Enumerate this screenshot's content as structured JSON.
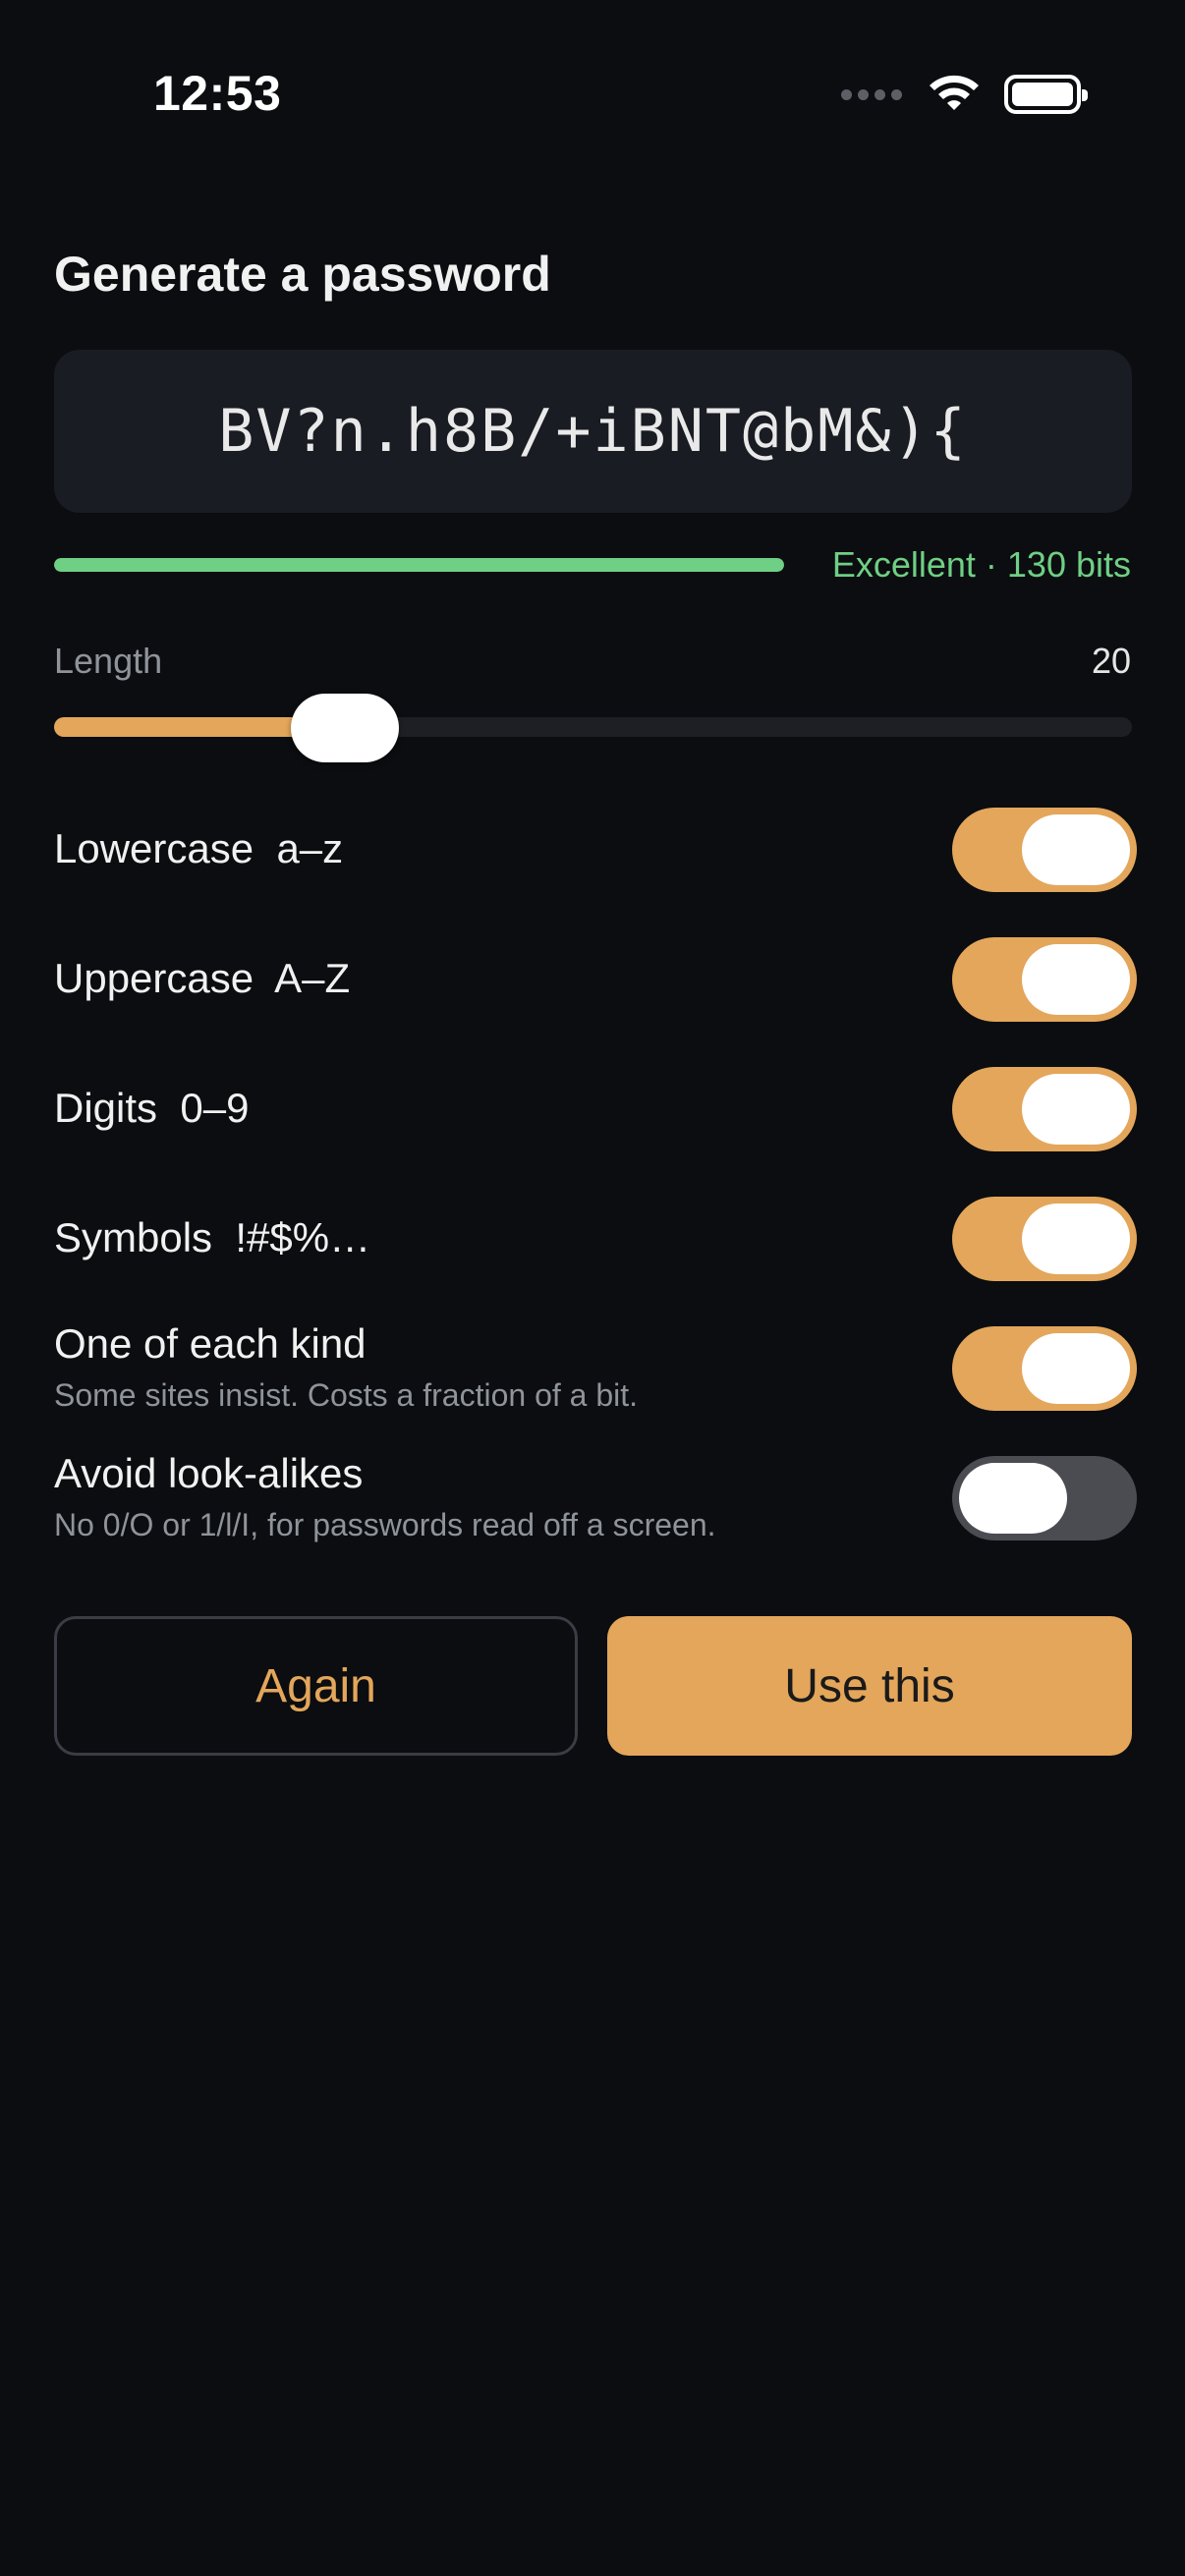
{
  "status_bar": {
    "time": "12:53"
  },
  "title": "Generate a password",
  "password": "BV?n.h8B/+iBNT@bM&){",
  "strength": {
    "label": "Excellent · 130 bits",
    "fraction": 1.0,
    "color": "#6fcf84"
  },
  "length": {
    "label": "Length",
    "value": "20",
    "fraction": 0.22
  },
  "options": [
    {
      "label": "Lowercase  a–z",
      "subtitle": "",
      "on": true
    },
    {
      "label": "Uppercase  A–Z",
      "subtitle": "",
      "on": true
    },
    {
      "label": "Digits  0–9",
      "subtitle": "",
      "on": true
    },
    {
      "label": "Symbols  !#$%…",
      "subtitle": "",
      "on": true
    },
    {
      "label": "One of each kind",
      "subtitle": "Some sites insist. Costs a fraction of a bit.",
      "on": true
    },
    {
      "label": "Avoid look-alikes",
      "subtitle": "No 0/O or 1/l/I, for passwords read off a screen.",
      "on": false
    }
  ],
  "buttons": {
    "again": "Again",
    "use": "Use this"
  },
  "colors": {
    "accent": "#e3a65a",
    "background": "#0b0d10",
    "success": "#6fcf84"
  },
  "icons": {
    "wifi": "wifi-icon",
    "battery": "battery-icon",
    "signal": "signal-dots-icon"
  }
}
